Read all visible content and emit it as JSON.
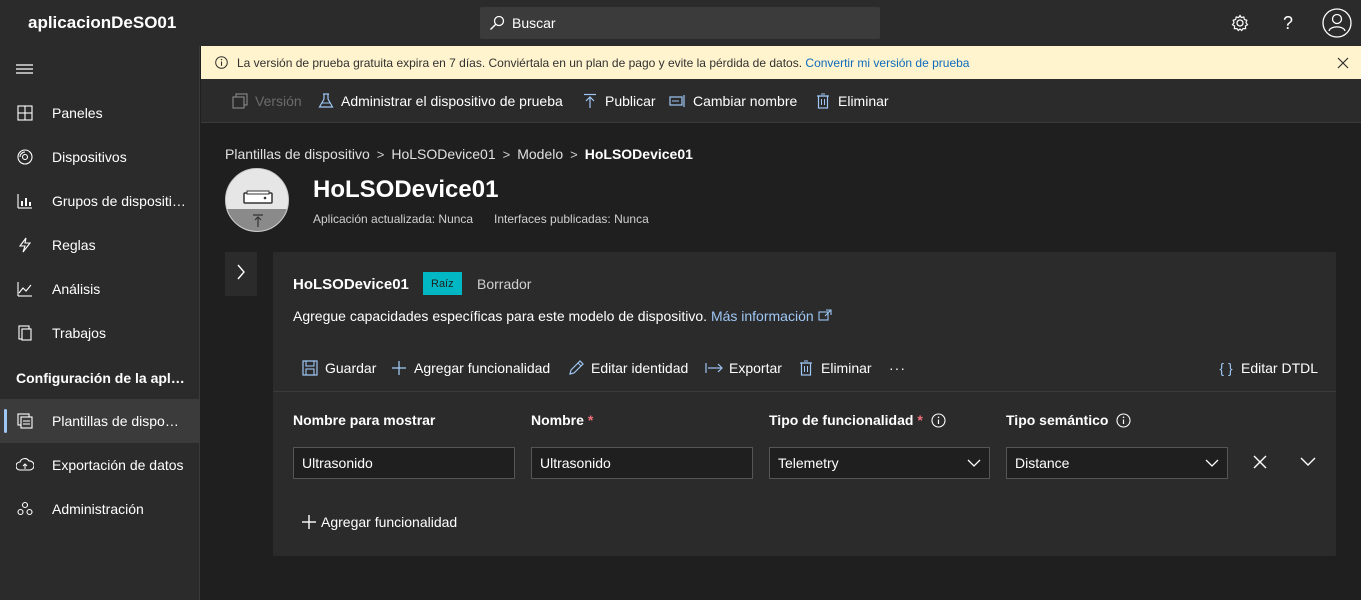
{
  "app": {
    "title": "aplicacionDeSO01"
  },
  "search": {
    "placeholder": "Buscar"
  },
  "sidebar": {
    "items": [
      {
        "label": "Paneles"
      },
      {
        "label": "Dispositivos"
      },
      {
        "label": "Grupos de dispositi…"
      },
      {
        "label": "Reglas"
      },
      {
        "label": "Análisis"
      },
      {
        "label": "Trabajos"
      }
    ],
    "section_label": "Configuración de la apli…",
    "config_items": [
      {
        "label": "Plantillas de dispo…"
      },
      {
        "label": "Exportación de datos"
      },
      {
        "label": "Administración"
      }
    ]
  },
  "banner": {
    "text": "La versión de prueba gratuita expira en 7 días. Conviértala en un plan de pago y evite la pérdida de datos.",
    "link": "Convertir mi versión de prueba"
  },
  "commandbar": {
    "version": "Versión",
    "manage": "Administrar el dispositivo de prueba",
    "publish": "Publicar",
    "rename": "Cambiar nombre",
    "delete": "Eliminar"
  },
  "breadcrumb": {
    "items": [
      "Plantillas de dispositivo",
      "HoLSODevice01",
      "Modelo"
    ],
    "current": "HoLSODevice01"
  },
  "device": {
    "title": "HoLSODevice01",
    "app_updated": "Aplicación actualizada: Nunca",
    "interfaces_published": "Interfaces publicadas: Nunca"
  },
  "card": {
    "name": "HoLSODevice01",
    "badge": "Raíz",
    "status": "Borrador",
    "description": "Agregue capacidades específicas para este modelo de dispositivo.",
    "more_info": "Más información",
    "commands": {
      "save": "Guardar",
      "add": "Agregar funcionalidad",
      "edit_identity": "Editar identidad",
      "export": "Exportar",
      "delete": "Eliminar",
      "more": "···",
      "edit_dtdl": "Editar DTDL"
    },
    "columns": {
      "display_name": "Nombre para mostrar",
      "name": "Nombre",
      "capability_type": "Tipo de funcionalidad",
      "semantic_type": "Tipo semántico"
    },
    "row": {
      "display_name": "Ultrasonido",
      "name": "Ultrasonido",
      "capability_type": "Telemetry",
      "semantic_type": "Distance"
    },
    "add_capability": "Agregar funcionalidad"
  },
  "colors": {
    "accent": "#9ec7f5",
    "badge": "#00b7c3",
    "banner_bg": "#fff4ce",
    "required": "#f1707b"
  }
}
